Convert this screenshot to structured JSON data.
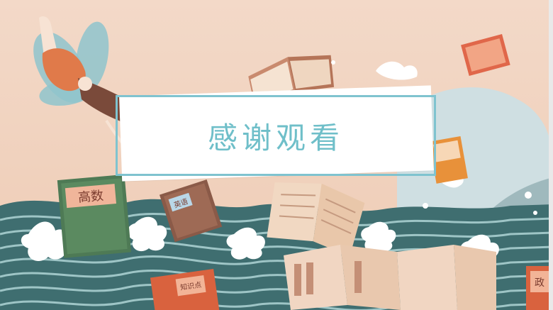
{
  "slide": {
    "title": "感谢观看"
  },
  "books": [
    {
      "label": "高数"
    },
    {
      "label": "英语"
    },
    {
      "label": "知识点"
    },
    {
      "label": "政"
    }
  ],
  "colors": {
    "background": "#f2d8c8",
    "frame": "#7fc3cf",
    "title_text": "#6fbfc9",
    "wave_dark": "#3d6c6e",
    "wave_light": "#a9cfd0",
    "fairy_dress": "#e07a4a"
  }
}
